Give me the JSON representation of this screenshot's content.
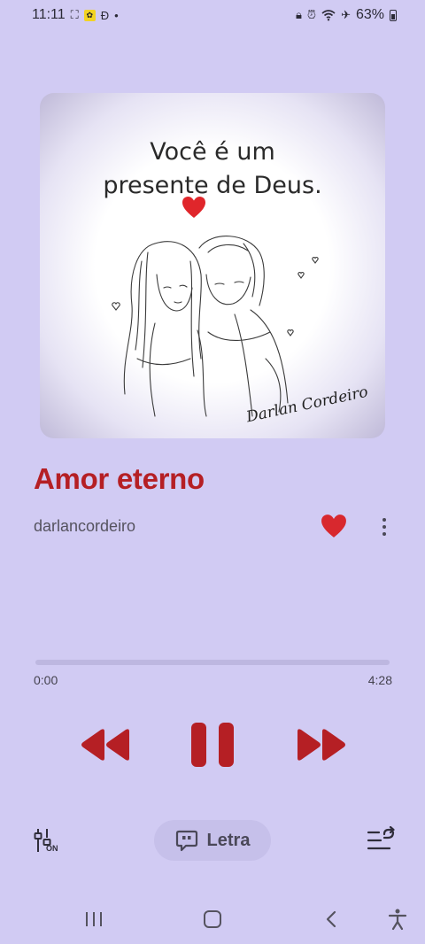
{
  "status_bar": {
    "time": "11:11",
    "battery": "63%"
  },
  "album_art": {
    "line1": "Você é um",
    "line2": "presente de Deus.",
    "signature": "Darlan Cordeiro"
  },
  "song": {
    "title": "Amor eterno",
    "artist": "darlancordeiro",
    "liked": true
  },
  "playback": {
    "current_time": "0:00",
    "total_time": "4:28",
    "progress": 0.0,
    "state": "playing"
  },
  "controls": {
    "eq_badge": "ON",
    "lyrics_label": "Letra"
  },
  "colors": {
    "background": "#d1cbf3",
    "accent": "#b51f24",
    "heart": "#d8282e"
  }
}
